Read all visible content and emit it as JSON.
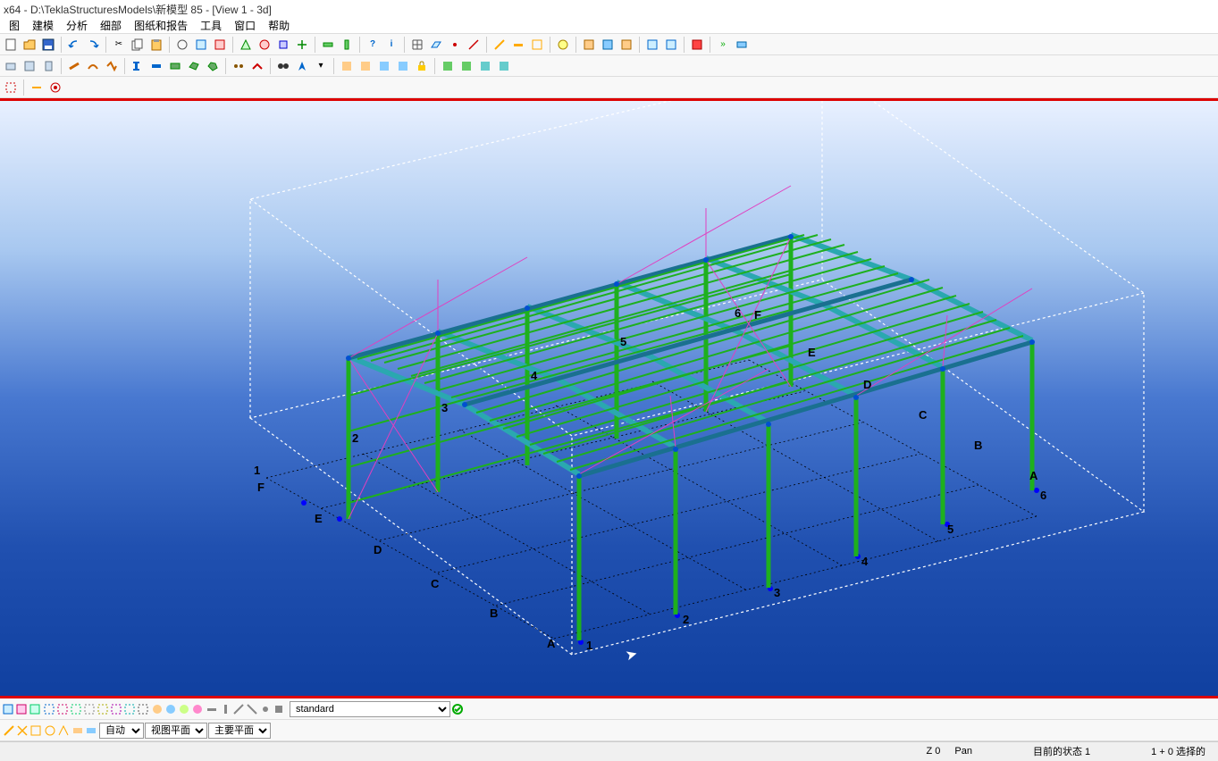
{
  "titlebar": "x64 - D:\\TeklaStructuresModels\\新模型 85  - [View 1 - 3d]",
  "menubar": [
    "图",
    "建模",
    "分析",
    "细部",
    "图纸和报告",
    "工具",
    "窗口",
    "帮助"
  ],
  "toolbar1_icons": [
    "new",
    "open",
    "save",
    "sep",
    "undo",
    "redo",
    "sep",
    "cut",
    "copy",
    "paste",
    "sep",
    "find",
    "sep",
    "macro1",
    "macro2",
    "sep",
    "script1",
    "script2",
    "sep",
    "q1",
    "q2",
    "sep",
    "grid",
    "plane",
    "point",
    "line",
    "sep",
    "arc",
    "circle",
    "sep",
    "beam",
    "column",
    "sep",
    "comp1",
    "comp2",
    "comp3",
    "sep",
    "view",
    "sep",
    "num1",
    "num2",
    "num3",
    "sep",
    "red",
    "sep",
    "dbl1",
    "dbl2"
  ],
  "toolbar2_icons": [
    "box",
    "front",
    "side",
    "sep",
    "u1",
    "u2",
    "u3",
    "sep",
    "straight",
    "curve",
    "rect",
    "poly",
    "sep",
    "dot1",
    "dot2",
    "sep",
    "binoc",
    "navi",
    "dd",
    "sep",
    "orange1",
    "orange2",
    "blue1",
    "blue2",
    "lock",
    "sep",
    "green1",
    "green2",
    "cyan1",
    "cyan2"
  ],
  "toolbar3_icons": [
    "sel1",
    "sel2",
    "sep",
    "origin"
  ],
  "grid_numbers": [
    "1",
    "2",
    "3",
    "4",
    "5",
    "6"
  ],
  "grid_letters": [
    "A",
    "B",
    "C",
    "D",
    "E",
    "F"
  ],
  "bottom_toolbar_icons": [
    "b1",
    "b2",
    "b3",
    "b4",
    "b5",
    "b6",
    "b7",
    "b8",
    "b9",
    "b10",
    "b11",
    "b12",
    "b13",
    "b14",
    "b15",
    "b16",
    "b17",
    "b18",
    "b19",
    "b20",
    "b21",
    "b22"
  ],
  "standard_dropdown": {
    "value": "standard"
  },
  "bottom2_icons": [
    "t1",
    "t2",
    "t3",
    "t4",
    "t5",
    "t6",
    "t7",
    "t8",
    "t9",
    "t10",
    "t11"
  ],
  "snap_dropdowns": {
    "d1": "自动",
    "d2": "视图平面",
    "d3": "主要平面"
  },
  "status": {
    "z": "Z  0",
    "pan": "Pan",
    "state": "目前的状态 1",
    "sel": "1 + 0 选择的"
  }
}
